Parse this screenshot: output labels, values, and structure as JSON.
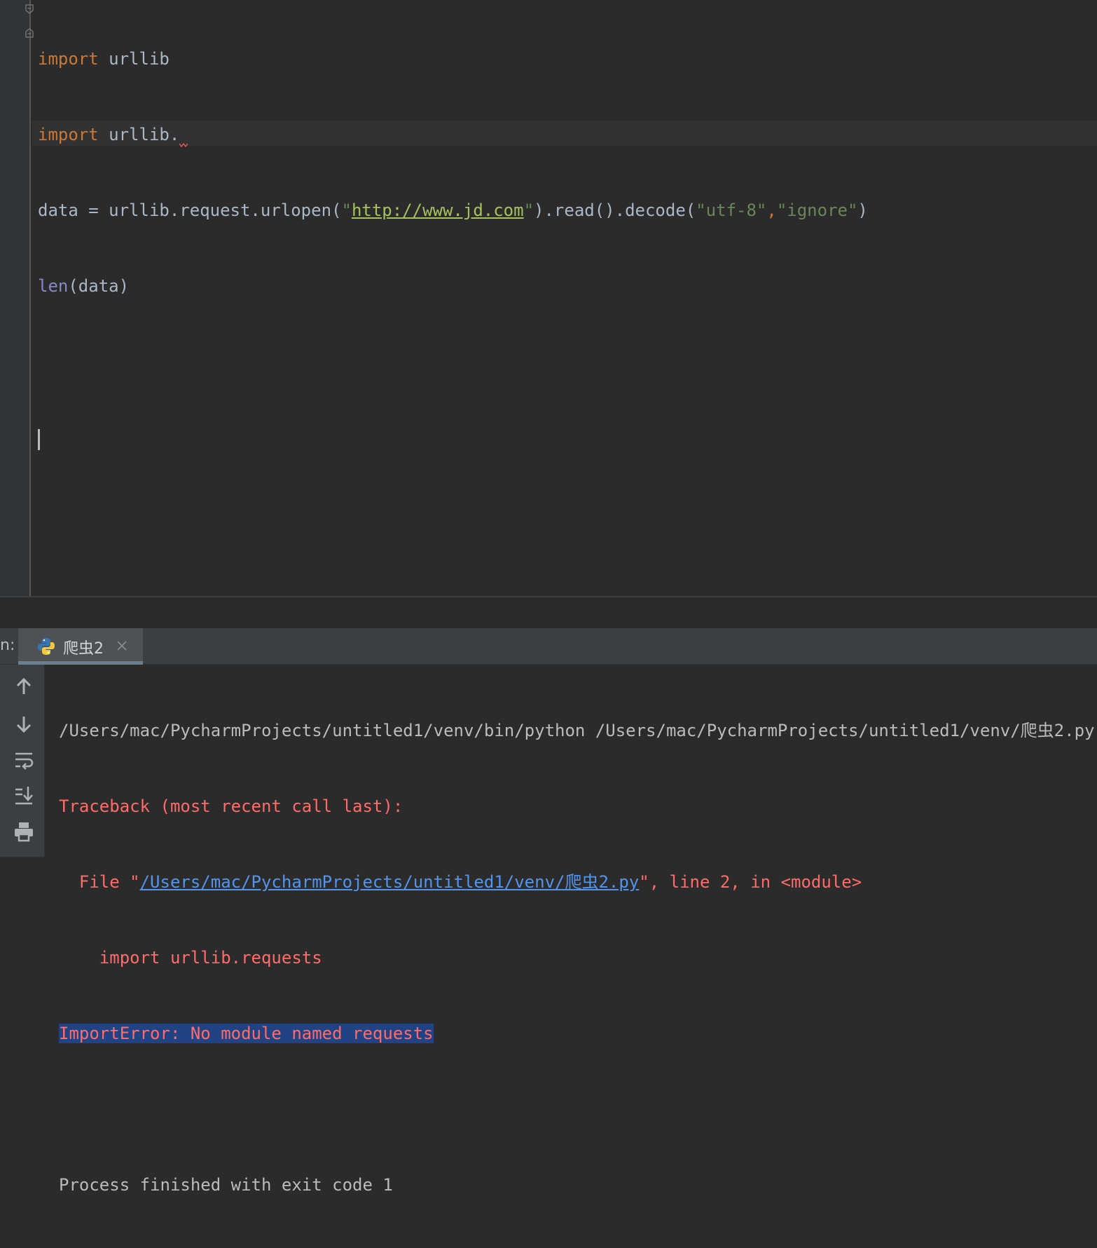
{
  "editor": {
    "lines": [
      {
        "kw": "import",
        "rest": " urllib"
      },
      {
        "kw": "import",
        "rest": " urllib."
      },
      {
        "a": "data = urllib.request.urlopen(",
        "s1": "\"",
        "url": "http://www.jd.com",
        "s2": "\"",
        "b": ").read().decode(",
        "s3": "\"utf-8\"",
        "c": ",",
        "s4": "\"ignore\"",
        "d": ")"
      },
      {
        "bi": "len",
        "rest": "(data)"
      }
    ]
  },
  "run_panel": {
    "label": "n:",
    "tab_title": "爬虫2",
    "console": {
      "cmd": "/Users/mac/PycharmProjects/untitled1/venv/bin/python /Users/mac/PycharmProjects/untitled1/venv/爬虫2.py",
      "traceback": "Traceback (most recent call last):",
      "file_prefix": "  File \"",
      "file_link": "/Users/mac/PycharmProjects/untitled1/venv/爬虫2.py",
      "file_suffix": "\", line 2, in <module>",
      "import_line": "    import urllib.requests",
      "error": "ImportError: No module named requests",
      "exit": "Process finished with exit code 1"
    }
  },
  "colors": {
    "editor_bg": "#2b2b2b",
    "keyword": "#cc7832",
    "string": "#6a8759",
    "error_text": "#ff6b68",
    "link": "#5394ec",
    "selection": "#214283"
  }
}
